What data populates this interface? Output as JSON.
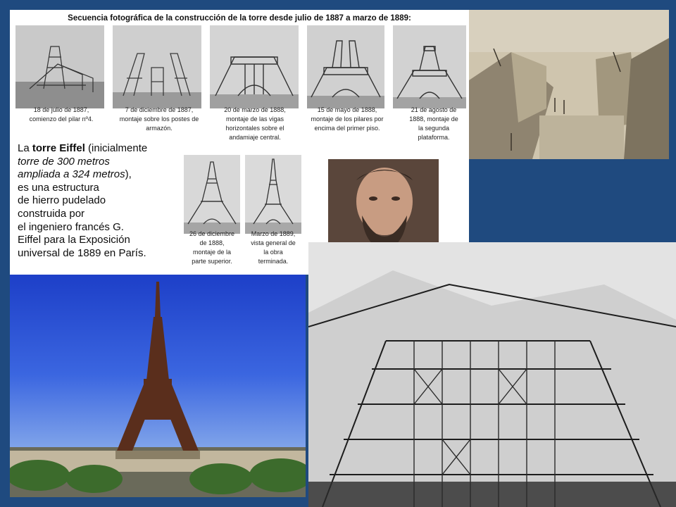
{
  "sequence": {
    "title": "Secuencia fotográfica de la construcción de la torre desde julio de 1887 a marzo de 1889:",
    "captions": [
      "18 de julio de 1887,\ncomienzo del pilar nº4.",
      "7 de diciembre de 1887,\nmontaje sobre los postes de\narmazón.",
      "20 de marzo de 1888,\nmontaje de las vigas\nhorizontales sobre el\nandamiaje central.",
      "15 de mayo de 1888,\nmontaje de los pilares por\nencima del primer piso.",
      "21 de agosto de\n1888, montaje de\nla segunda\nplataforma.",
      "26 de diciembre\nde 1888,\nmontaje de la\nparte superior.",
      "Marzo de 1889,\nvista general de\nla obra\nterminada."
    ]
  },
  "body": {
    "p1_pre": "La ",
    "p1_bold": "torre Eiffel",
    "p1_post": " (inicialmente",
    "p2_italic_a": "torre de 300 metros",
    "p3_italic_b": "ampliada a 324 metros",
    "p3_post": "),",
    "lines": [
      "es una estructura",
      "de hierro pudelado",
      "construida por",
      "el ingeniero francés G.",
      "Eiffel  para la Exposición",
      "universal de 1889 en París."
    ]
  },
  "colors": {
    "background": "#1f4a7f"
  }
}
